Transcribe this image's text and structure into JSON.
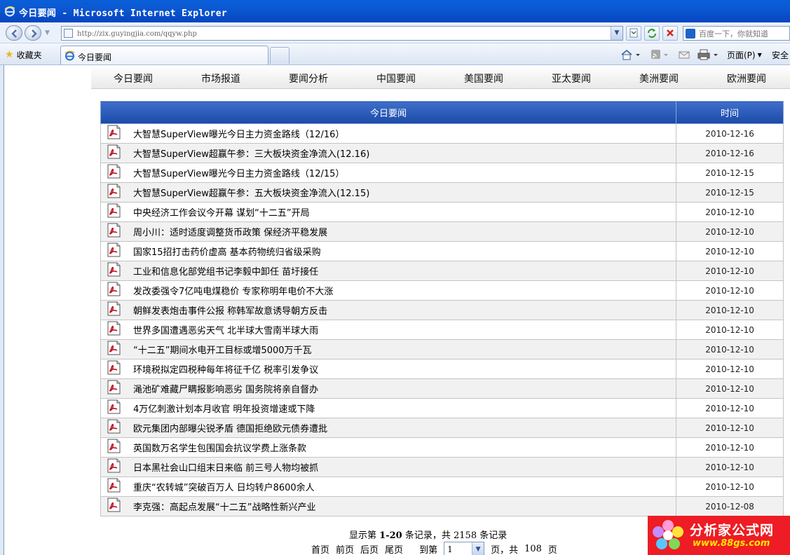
{
  "window": {
    "title": "今日要闻 - Microsoft Internet Explorer"
  },
  "address_bar": {
    "url": "http://zix.guyingjia.com/qqyw.php",
    "search_placeholder": "百度一下，你就知道"
  },
  "favorites_bar": {
    "favorites_label": "收藏夹",
    "active_tab_label": "今日要闻",
    "page_menu_label": "页面(P)",
    "safety_menu_label": "安全"
  },
  "category_nav": [
    "今日要闻",
    "市场报道",
    "要闻分析",
    "中国要闻",
    "美国要闻",
    "亚太要闻",
    "美洲要闻",
    "欧洲要闻"
  ],
  "table": {
    "col_title": "今日要闻",
    "col_time": "时间",
    "rows": [
      {
        "title": "大智慧SuperView曝光今日主力资金路线（12/16）",
        "date": "2010-12-16"
      },
      {
        "title": "大智慧SuperView超赢午参：三大板块资金净流入(12.16)",
        "date": "2010-12-16"
      },
      {
        "title": "大智慧SuperView曝光今日主力资金路线（12/15）",
        "date": "2010-12-15"
      },
      {
        "title": "大智慧SuperView超赢午参：五大板块资金净流入(12.15)",
        "date": "2010-12-15"
      },
      {
        "title": "中央经济工作会议今开幕 谋划“十二五”开局",
        "date": "2010-12-10"
      },
      {
        "title": "周小川：适时适度调整货币政策 保经济平稳发展",
        "date": "2010-12-10"
      },
      {
        "title": "国家15招打击药价虚高 基本药物统归省级采购",
        "date": "2010-12-10"
      },
      {
        "title": "工业和信息化部党组书记李毅中卸任 苗圩接任",
        "date": "2010-12-10"
      },
      {
        "title": "发改委强令7亿吨电煤稳价 专家称明年电价不大涨",
        "date": "2010-12-10"
      },
      {
        "title": "朝鲜发表炮击事件公报 称韩军故意诱导朝方反击",
        "date": "2010-12-10"
      },
      {
        "title": "世界多国遭遇恶劣天气 北半球大雪南半球大雨",
        "date": "2010-12-10"
      },
      {
        "title": "“十二五”期间水电开工目标或增5000万千瓦",
        "date": "2010-12-10"
      },
      {
        "title": "环境税拟定四税种每年将征千亿 税率引发争议",
        "date": "2010-12-10"
      },
      {
        "title": "渑池矿难藏尸瞒报影响恶劣 国务院将亲自督办",
        "date": "2010-12-10"
      },
      {
        "title": "4万亿刺激计划本月收官 明年投资增速或下降",
        "date": "2010-12-10"
      },
      {
        "title": "欧元集团内部曝尖锐矛盾 德国拒绝欧元债券遭批",
        "date": "2010-12-10"
      },
      {
        "title": "英国数万名学生包围国会抗议学费上涨条款",
        "date": "2010-12-10"
      },
      {
        "title": "日本黑社会山口组末日来临 前三号人物均被抓",
        "date": "2010-12-10"
      },
      {
        "title": "重庆“农转城”突破百万人 日均转户8600余人",
        "date": "2010-12-10"
      },
      {
        "title": "李克强：高起点发展“十二五”战略性新兴产业",
        "date": "2010-12-08"
      }
    ]
  },
  "footer": {
    "summary_prefix": "显示第",
    "summary_range": "1-20",
    "summary_mid": "条记录，共",
    "summary_total": "2158",
    "summary_suffix": "条记录",
    "first": "首页",
    "prev": "前页",
    "next": "后页",
    "last": "尾页",
    "goto_prefix": "到第",
    "current_page": "1",
    "goto_suffix": "页，共",
    "total_pages": "108",
    "pages_suffix": "页"
  },
  "watermark": {
    "brand": "分析家公式网",
    "url": "www.88gs.com"
  },
  "colors": {
    "title_bar": "#0645c0",
    "table_header": "#1b4aa8",
    "watermark_bg": "#ee1c24"
  }
}
